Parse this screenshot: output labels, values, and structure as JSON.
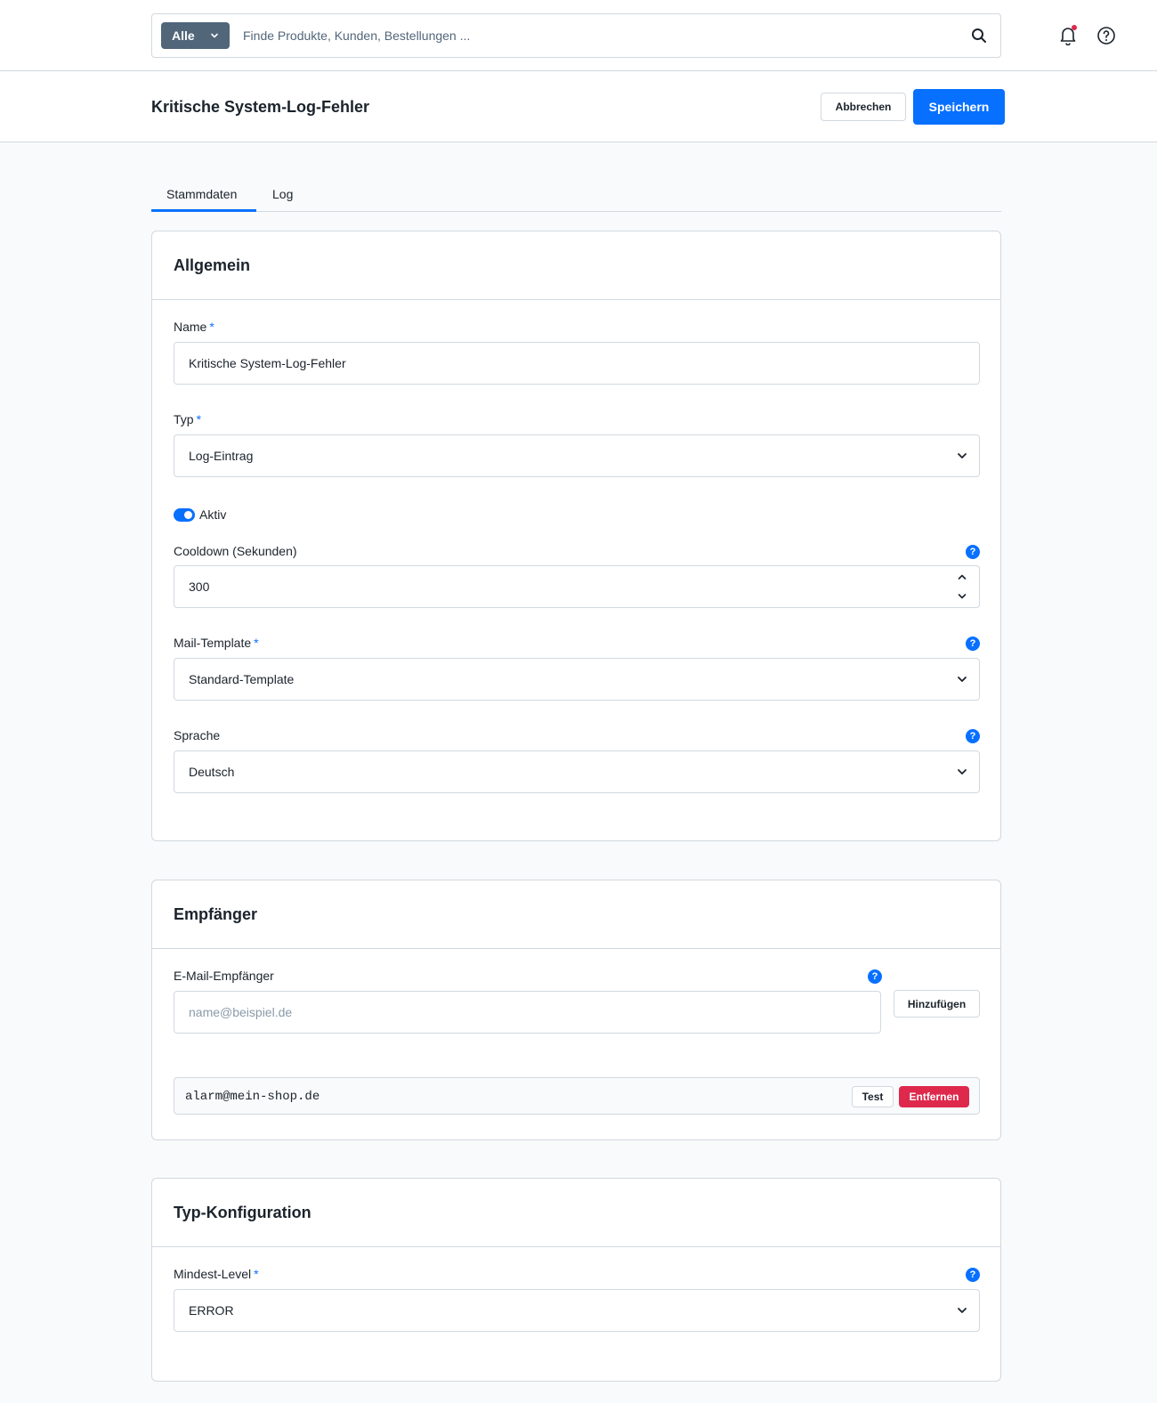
{
  "search": {
    "type_label": "Alle",
    "placeholder": "Finde Produkte, Kunden, Bestellungen ..."
  },
  "header": {
    "title": "Kritische System-Log-Fehler",
    "cancel_label": "Abbrechen",
    "save_label": "Speichern"
  },
  "tabs": [
    {
      "label": "Stammdaten",
      "active": true
    },
    {
      "label": "Log",
      "active": false
    }
  ],
  "general": {
    "title": "Allgemein",
    "name_label": "Name",
    "name_value": "Kritische System-Log-Fehler",
    "type_label": "Typ",
    "type_value": "Log-Eintrag",
    "active_label": "Aktiv",
    "active": true,
    "cooldown_label": "Cooldown (Sekunden)",
    "cooldown_value": "300",
    "template_label": "Mail-Template",
    "template_value": "Standard-Template",
    "language_label": "Sprache",
    "language_value": "Deutsch",
    "required_marker": "*",
    "info_glyph": "?"
  },
  "recipients": {
    "title": "Empfänger",
    "email_label": "E-Mail-Empfänger",
    "email_placeholder": "name@beispiel.de",
    "add_label": "Hinzufügen",
    "list": [
      {
        "email": "alarm@mein-shop.de",
        "test_label": "Test",
        "remove_label": "Entfernen"
      }
    ]
  },
  "type_config": {
    "title": "Typ-Konfiguration",
    "level_label": "Mindest-Level",
    "level_value": "ERROR"
  },
  "colors": {
    "accent": "#0870ff",
    "danger": "#de294c",
    "search_type_bg": "#52667a",
    "border": "#d1d9e0",
    "page_bg": "#f9fafb"
  }
}
